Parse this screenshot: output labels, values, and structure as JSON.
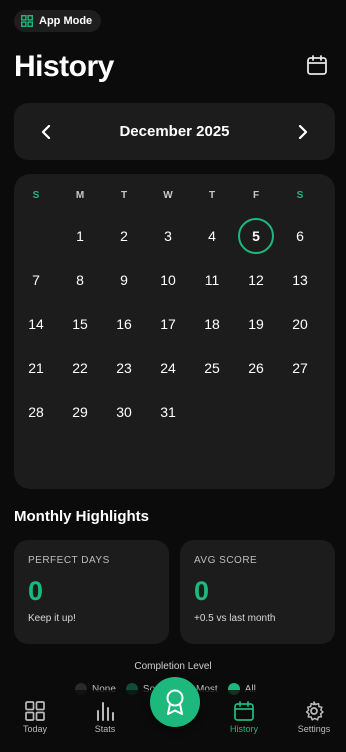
{
  "app_mode": {
    "label": "App Mode",
    "icon": "grid-icon"
  },
  "header": {
    "title": "History",
    "calendar_icon": "calendar-icon"
  },
  "month_nav": {
    "label": "December 2025",
    "prev_icon": "chevron-left-icon",
    "next_icon": "chevron-right-icon"
  },
  "calendar": {
    "weekdays": [
      "S",
      "M",
      "T",
      "W",
      "T",
      "F",
      "S"
    ],
    "days": [
      "1",
      "2",
      "3",
      "4",
      "5",
      "6",
      "7",
      "8",
      "9",
      "10",
      "11",
      "12",
      "13",
      "14",
      "15",
      "16",
      "17",
      "18",
      "19",
      "20",
      "21",
      "22",
      "23",
      "24",
      "25",
      "26",
      "27",
      "28",
      "29",
      "30",
      "31"
    ],
    "first_weekday_index": 1,
    "selected_day": "5"
  },
  "highlights": {
    "title": "Monthly Highlights",
    "perfect_days": {
      "label": "PERFECT DAYS",
      "value": "0",
      "sub": "Keep it up!"
    },
    "avg_score": {
      "label": "AVG SCORE",
      "value": "0",
      "sub": "+0.5 vs last month"
    }
  },
  "completion": {
    "title": "Completion Level",
    "levels": [
      {
        "label": "None",
        "color": "#2a2a2a"
      },
      {
        "label": "Some",
        "color": "#0f4d36"
      },
      {
        "label": "Most",
        "color": "#168a5d"
      },
      {
        "label": "All",
        "color": "#1db97c"
      }
    ]
  },
  "nav": {
    "items": [
      {
        "label": "Today",
        "icon": "grid-icon"
      },
      {
        "label": "Stats",
        "icon": "bar-chart-icon"
      },
      {
        "label": "History",
        "icon": "calendar-icon"
      },
      {
        "label": "Settings",
        "icon": "gear-icon"
      }
    ],
    "fab_icon": "award-icon",
    "active": "History"
  },
  "colors": {
    "accent": "#1db97c",
    "surface": "#1c1c1c",
    "background": "#0b0b0b"
  }
}
